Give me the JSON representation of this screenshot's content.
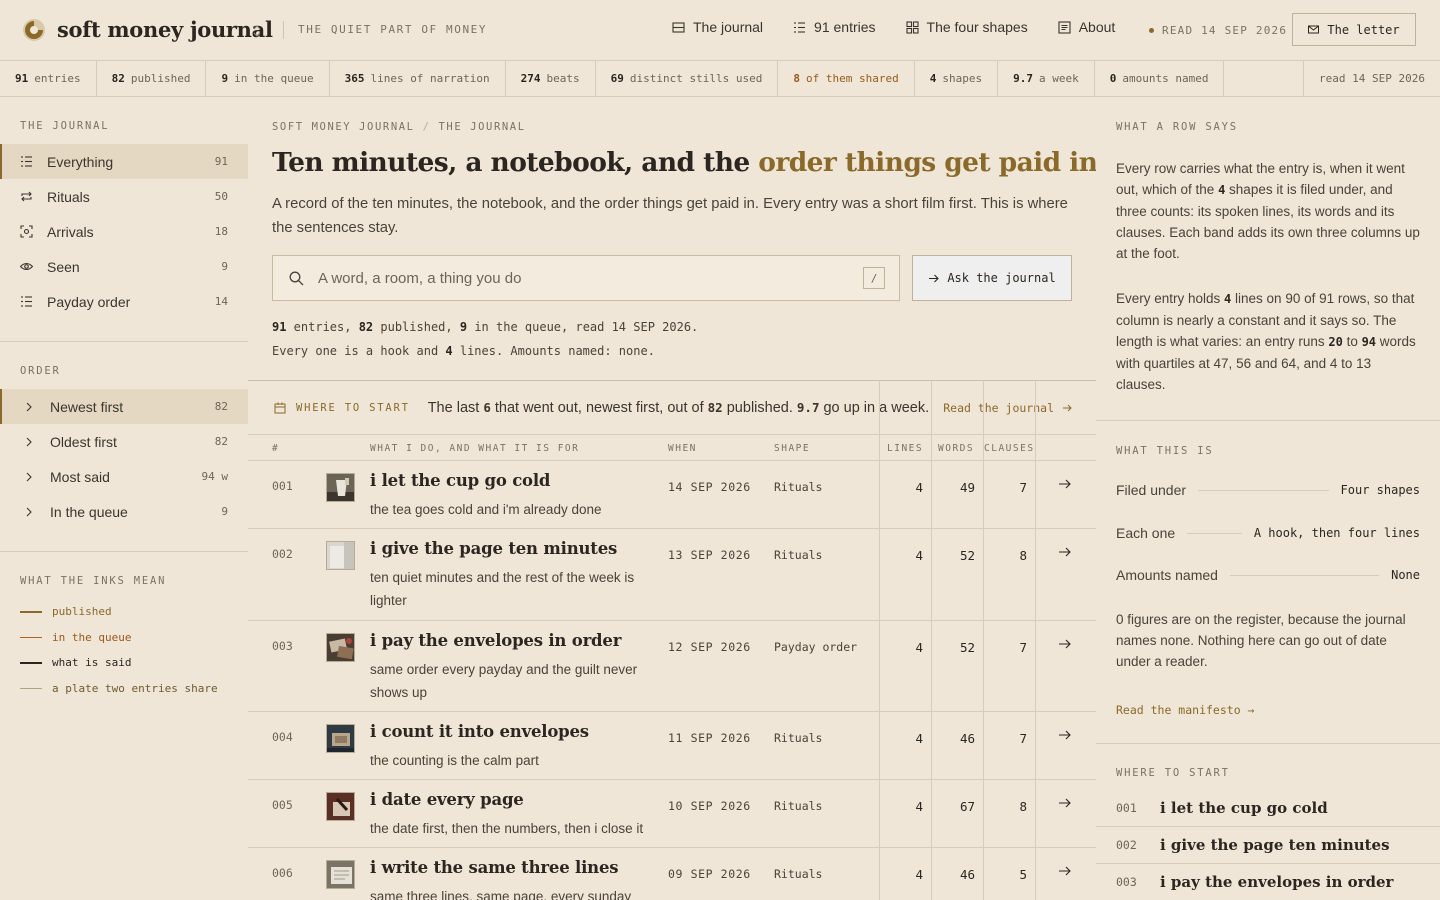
{
  "header": {
    "brand": "soft money journal",
    "tagline": "THE QUIET PART OF MONEY",
    "nav": [
      {
        "label": "The journal",
        "icon": "journal-icon"
      },
      {
        "label": "91 entries",
        "icon": "list-icon"
      },
      {
        "label": "The four shapes",
        "icon": "grid-icon"
      },
      {
        "label": "About",
        "icon": "document-icon"
      }
    ],
    "read_date": "READ 14 SEP 2026",
    "letter_label": "The letter"
  },
  "stats": [
    {
      "value": "91",
      "label": "entries"
    },
    {
      "value": "82",
      "label": "published"
    },
    {
      "value": "9",
      "label": "in the queue"
    },
    {
      "value": "365",
      "label": "lines of narration"
    },
    {
      "value": "274",
      "label": "beats"
    },
    {
      "value": "69",
      "label": "distinct stills used"
    },
    {
      "value": "8",
      "label": "of them shared"
    },
    {
      "value": "4",
      "label": "shapes"
    },
    {
      "value": "9.7",
      "label": "a week"
    },
    {
      "value": "0",
      "label": "amounts named"
    }
  ],
  "stats_read": "read 14 SEP 2026",
  "sidebar": {
    "journal_title": "THE JOURNAL",
    "journal_items": [
      {
        "label": "Everything",
        "count": "91"
      },
      {
        "label": "Rituals",
        "count": "50"
      },
      {
        "label": "Arrivals",
        "count": "18"
      },
      {
        "label": "Seen",
        "count": "9"
      },
      {
        "label": "Payday order",
        "count": "14"
      }
    ],
    "order_title": "ORDER",
    "order_items": [
      {
        "label": "Newest first",
        "count": "82"
      },
      {
        "label": "Oldest first",
        "count": "82"
      },
      {
        "label": "Most said",
        "count": "94 w"
      },
      {
        "label": "In the queue",
        "count": "9"
      }
    ],
    "legend_title": "WHAT THE INKS MEAN",
    "legend": [
      {
        "label": "published",
        "color": "#8a6a2a"
      },
      {
        "label": "in the queue",
        "color": "#b2641e"
      },
      {
        "label": "what is said",
        "color": "#2b2620"
      },
      {
        "label": "a plate two entries share",
        "color": "#b3a27e"
      }
    ]
  },
  "main": {
    "crumb_1": "SOFT MONEY JOURNAL",
    "crumb_sep": "/",
    "crumb_2": "THE JOURNAL",
    "headline_a": "Ten minutes, a notebook, and the ",
    "headline_b": "order things get paid in",
    "lede": "A record of the ten minutes, the notebook, and the order things get paid in. Every entry was a short film first. This is where the sentences stay.",
    "search_placeholder": "A word, a room, a thing you do",
    "search_key": "/",
    "ask_label": "Ask the journal",
    "summary": {
      "n_entries": "91",
      "t_entries": " entries, ",
      "n_published": "82",
      "t_published": " published, ",
      "n_queue": "9",
      "t_queue": " in the queue, read 14 SEP 2026.",
      "t_hook": "Every one is a hook and ",
      "n_lines": "4",
      "t_lines": " lines. Amounts named: none."
    },
    "start": {
      "label": "WHERE TO START",
      "t1": "The last ",
      "n1": "6",
      "t2": " that went out, newest first, out of ",
      "n2": "82",
      "t3": " published. ",
      "n3": "9.7",
      "t4": " go up in a week.",
      "link": "Read the journal"
    },
    "columns": {
      "num": "#",
      "what": "WHAT I DO, AND WHAT IT IS FOR",
      "when": "WHEN",
      "shape": "SHAPE",
      "lines": "LINES",
      "words": "WORDS",
      "clauses": "CLAUSES"
    },
    "rows": [
      {
        "num": "001",
        "title": "i let the cup go cold",
        "sub": "the tea goes cold and i'm already done",
        "when": "14 SEP 2026",
        "shape": "Rituals",
        "lines": "4",
        "words": "49",
        "clauses": "7"
      },
      {
        "num": "002",
        "title": "i give the page ten minutes",
        "sub": "ten quiet minutes and the rest of the week is lighter",
        "when": "13 SEP 2026",
        "shape": "Rituals",
        "lines": "4",
        "words": "52",
        "clauses": "8"
      },
      {
        "num": "003",
        "title": "i pay the envelopes in order",
        "sub": "same order every payday and the guilt never shows up",
        "when": "12 SEP 2026",
        "shape": "Payday order",
        "lines": "4",
        "words": "52",
        "clauses": "7"
      },
      {
        "num": "004",
        "title": "i count it into envelopes",
        "sub": "the counting is the calm part",
        "when": "11 SEP 2026",
        "shape": "Rituals",
        "lines": "4",
        "words": "46",
        "clauses": "7"
      },
      {
        "num": "005",
        "title": "i date every page",
        "sub": "the date first, then the numbers, then i close it",
        "when": "10 SEP 2026",
        "shape": "Rituals",
        "lines": "4",
        "words": "67",
        "clauses": "8"
      },
      {
        "num": "006",
        "title": "i write the same three lines",
        "sub": "same three lines, same page, every sunday",
        "when": "09 SEP 2026",
        "shape": "Rituals",
        "lines": "4",
        "words": "46",
        "clauses": "5"
      }
    ]
  },
  "right": {
    "row_title": "WHAT A ROW SAYS",
    "p1": {
      "t1": "Every row carries what the entry is, when it went out, which of the ",
      "n1": "4",
      "t2": " shapes it is filed under, and three counts: its spoken lines, its words and its clauses. Each band adds its own three columns up at the foot."
    },
    "p2": {
      "t1": "Every entry holds ",
      "n1": "4",
      "t2": " lines on 90 of 91 rows, so that column is nearly a constant and it says so. The length is what varies: an entry runs ",
      "n2": "20",
      "t3": " to ",
      "n3": "94",
      "t4": " words with quartiles at 47, 56 and 64, and 4 to 13 clauses."
    },
    "what_title": "WHAT THIS IS",
    "kv": [
      {
        "k": "Filed under",
        "v": "Four shapes"
      },
      {
        "k": "Each one",
        "v": "A hook, then four lines"
      },
      {
        "k": "Amounts named",
        "v": "None"
      }
    ],
    "p3": "0 figures are on the register, because the journal names none. Nothing here can go out of date under a reader.",
    "manifesto": "Read the manifesto →",
    "start_title": "WHERE TO START",
    "picks": [
      {
        "num": "001",
        "title": "i let the cup go cold"
      },
      {
        "num": "002",
        "title": "i give the page ten minutes"
      },
      {
        "num": "003",
        "title": "i pay the envelopes in order"
      }
    ]
  }
}
